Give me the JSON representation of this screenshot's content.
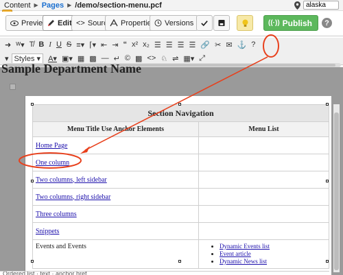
{
  "breadcrumb": {
    "root": "Content",
    "section": "Pages",
    "path": "/demo/section-menu.pcf"
  },
  "location": {
    "value": "alaska"
  },
  "toolbar": {
    "preview": "Preview",
    "edit": "Edit",
    "source": "Source",
    "properties": "Properties",
    "versions": "Versions",
    "publish": "Publish"
  },
  "editor": {
    "styles_label": "Styles",
    "heading_text": "Sample Department Name"
  },
  "table": {
    "caption": "Section Navigation",
    "col1": "Menu Title Use Anchor Elements",
    "col2": "Menu List",
    "rows": [
      "Home Page",
      "One column",
      "Two columns, left sidebar",
      "Two columns, right sidebar",
      "Three columns",
      "Snippets"
    ],
    "last_row_label": "Events and Events",
    "last_row_list": [
      "Dynamic Events list",
      "Event article",
      "Dynamic News list"
    ]
  },
  "status_text": "Ordered list · text · anchor href ...",
  "colors": {
    "publish": "#5cb85c",
    "annotation": "#e8401c",
    "link": "#1a0dab",
    "accent": "#1a6fd0"
  },
  "icons": [
    "map-marker-icon",
    "eye-icon",
    "pencil-icon",
    "code-icon",
    "sliders-icon",
    "history-icon",
    "check-icon",
    "save-icon",
    "lightbulb-icon",
    "broadcast-icon",
    "chevron-down-icon",
    "help-icon",
    "link-icon",
    "unlink-icon",
    "envelope-icon",
    "anchor-icon"
  ]
}
